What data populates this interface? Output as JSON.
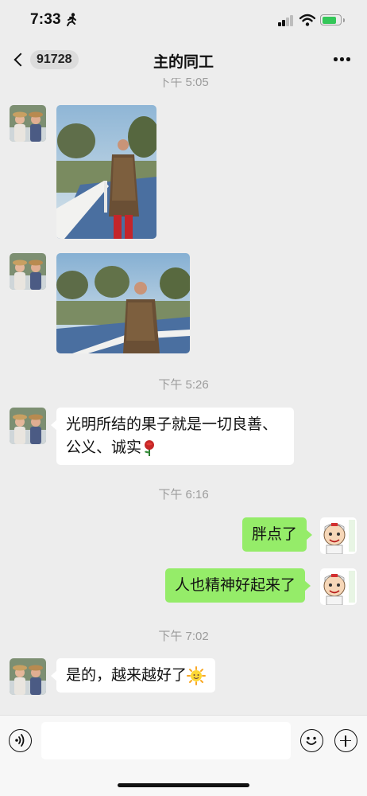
{
  "status_bar": {
    "time": "7:33",
    "activity_icon": "running-figure-icon",
    "battery_color": "#34c759"
  },
  "nav": {
    "back_icon": "chevron-left-icon",
    "unread_count": "91728",
    "title": "主的同工",
    "more_icon": "ellipsis-icon"
  },
  "messages": [
    {
      "type": "timestamp",
      "text": "下午 5:05"
    },
    {
      "type": "image",
      "direction": "incoming",
      "content": "photo-man-leopard-shirt-on-bridge-portrait"
    },
    {
      "type": "image",
      "direction": "incoming",
      "content": "photo-man-leopard-shirt-on-bridge-landscape"
    },
    {
      "type": "timestamp",
      "text": "下午 5:26"
    },
    {
      "type": "text",
      "direction": "incoming",
      "text_line1": "光明所结的果子就是一切良善、",
      "text_line2": "公义、诚实",
      "emoji": "rose-emoji"
    },
    {
      "type": "timestamp",
      "text": "下午 6:16"
    },
    {
      "type": "text",
      "direction": "outgoing",
      "text": "胖点了"
    },
    {
      "type": "text",
      "direction": "outgoing",
      "text": "人也精神好起来了"
    },
    {
      "type": "timestamp",
      "text": "下午 7:02"
    },
    {
      "type": "text",
      "direction": "incoming",
      "text": "是的，越来越好了",
      "emoji": "sun-emoji"
    }
  ],
  "colors": {
    "background": "#ededed",
    "outgoing_bubble": "#95ec69",
    "incoming_bubble": "#ffffff",
    "timestamp": "#9c9c9c"
  },
  "input_bar": {
    "voice_icon": "voice-input-icon",
    "message_input_value": "",
    "emoji_icon": "emoji-face-icon",
    "plus_icon": "plus-circle-icon"
  }
}
